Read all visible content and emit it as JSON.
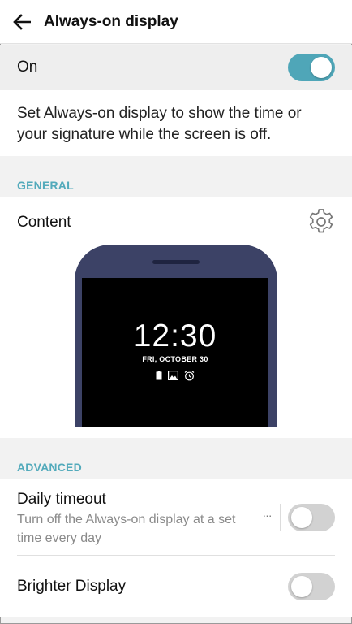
{
  "appbar": {
    "title": "Always-on display",
    "back_icon": "arrow-left-icon"
  },
  "master_switch": {
    "label": "On",
    "enabled": true,
    "accent_color": "#4fa6b8"
  },
  "description": "Set Always-on display to show the time or your signature while the screen is off.",
  "general": {
    "header": "GENERAL",
    "content": {
      "label": "Content",
      "settings_icon": "gear-icon",
      "preview": {
        "time": "12:30",
        "date": "FRI, OCTOBER 30",
        "status_icons": [
          "battery-icon",
          "image-icon",
          "alarm-icon"
        ]
      }
    }
  },
  "advanced": {
    "header": "ADVANCED",
    "daily_timeout": {
      "title": "Daily timeout",
      "subtitle": "Turn off the Always-on display at a set time every day",
      "more_label": "···",
      "enabled": false
    },
    "brighter_display": {
      "title": "Brighter Display",
      "enabled": false
    }
  },
  "colors": {
    "section_header": "#52aabb",
    "phone_body": "#3c4266"
  }
}
